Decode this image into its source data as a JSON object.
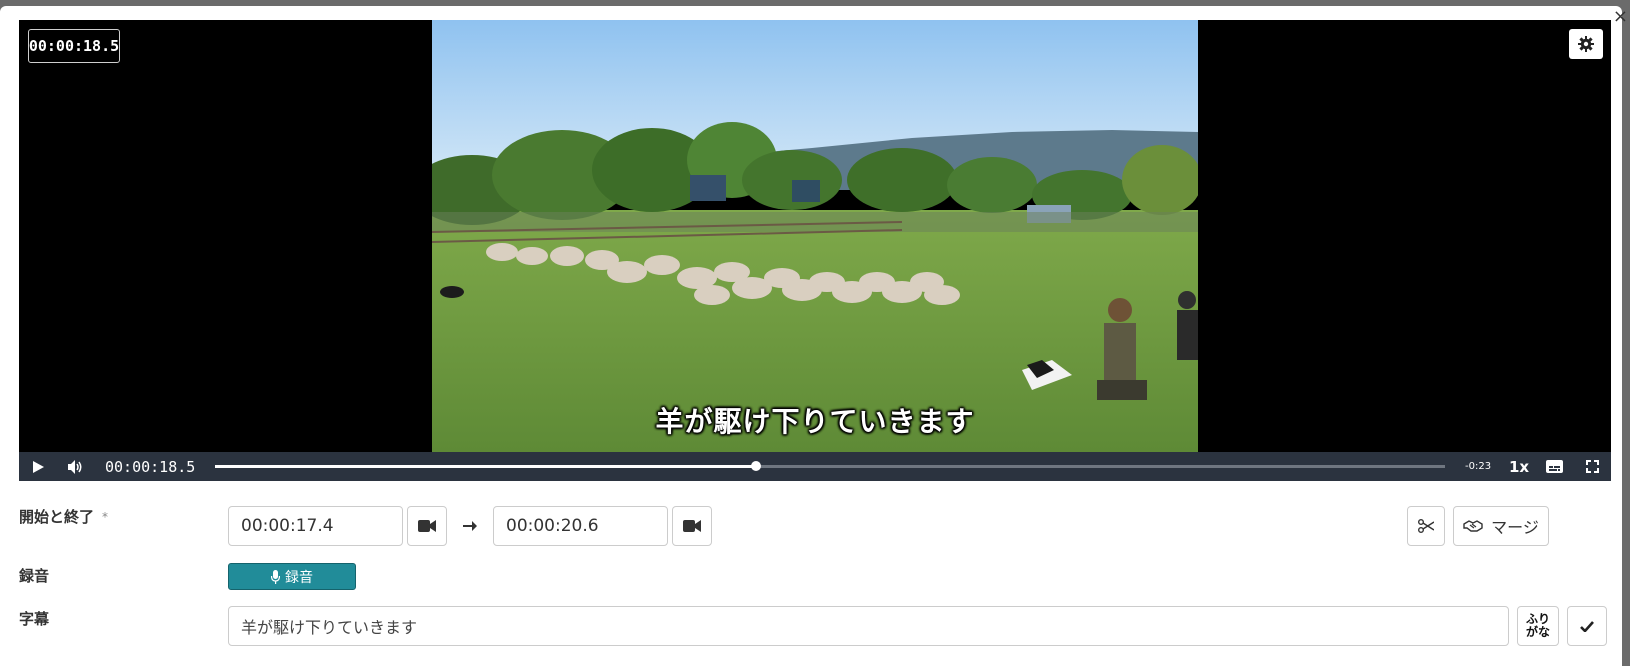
{
  "player": {
    "overlay_timecode": "00:00:18.5",
    "caption": "羊が駆け下りていきます",
    "controls": {
      "current_time": "00:00:18.5",
      "remaining_time": "-0:23",
      "playback_rate": "1x",
      "progress_fraction": 0.44
    },
    "settings_icon": "gear-icon",
    "close_symbol": "×"
  },
  "form": {
    "start_end": {
      "label": "開始と終了",
      "required_mark": "*",
      "start_value": "00:00:17.4",
      "end_value": "00:00:20.6",
      "merge_label": "マージ"
    },
    "recording": {
      "label": "録音",
      "button_label": "録音"
    },
    "subtitle": {
      "label": "字幕",
      "value": "羊が駆け下りていきます",
      "furigana_label_line1": "ふり",
      "furigana_label_line2": "がな"
    }
  },
  "colors": {
    "record_button": "#218c99",
    "control_bar": "#2b333f"
  }
}
